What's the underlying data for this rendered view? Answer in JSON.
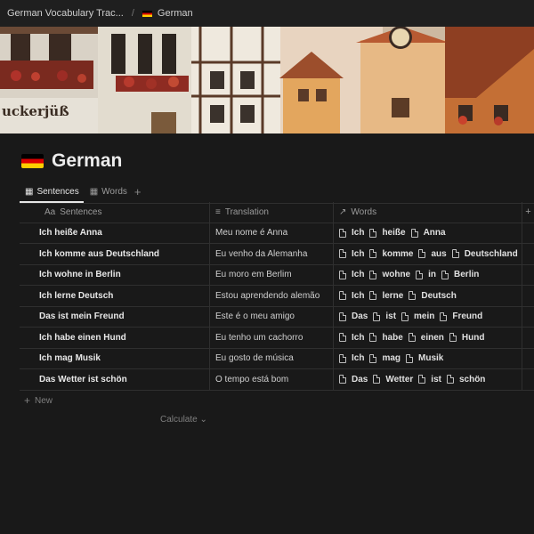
{
  "breadcrumb": {
    "parent": "German Vocabulary Trac...",
    "separator": "/",
    "current": "German"
  },
  "page": {
    "title": "German"
  },
  "views": {
    "tabs": [
      {
        "label": "Sentences",
        "icon": "table-icon",
        "active": true
      },
      {
        "label": "Words",
        "icon": "table-icon",
        "active": false
      }
    ],
    "add": "+"
  },
  "table": {
    "columns": [
      {
        "label": "Sentences",
        "icon": "Aa"
      },
      {
        "label": "Translation",
        "icon": "text-lines-icon"
      },
      {
        "label": "Words",
        "icon": "relation-arrow-icon"
      }
    ],
    "rows": [
      {
        "sentence": "Ich heiße Anna",
        "translation": "Meu nome é Anna",
        "words": [
          "Ich",
          "heiße",
          "Anna"
        ]
      },
      {
        "sentence": "Ich komme aus Deutschland",
        "translation": "Eu venho da Alemanha",
        "words": [
          "Ich",
          "komme",
          "aus",
          "Deutschland"
        ]
      },
      {
        "sentence": "Ich wohne in Berlin",
        "translation": "Eu moro em Berlim",
        "words": [
          "Ich",
          "wohne",
          "in",
          "Berlin"
        ]
      },
      {
        "sentence": "Ich lerne Deutsch",
        "translation": "Estou aprendendo alemão",
        "words": [
          "Ich",
          "lerne",
          "Deutsch"
        ]
      },
      {
        "sentence": "Das ist mein Freund",
        "translation": "Este é o meu amigo",
        "words": [
          "Das",
          "ist",
          "mein",
          "Freund"
        ]
      },
      {
        "sentence": "Ich habe einen Hund",
        "translation": "Eu tenho um cachorro",
        "words": [
          "Ich",
          "habe",
          "einen",
          "Hund"
        ]
      },
      {
        "sentence": "Ich mag Musik",
        "translation": "Eu gosto de música",
        "words": [
          "Ich",
          "mag",
          "Musik"
        ]
      },
      {
        "sentence": "Das Wetter ist schön",
        "translation": "O tempo está bom",
        "words": [
          "Das",
          "Wetter",
          "ist",
          "schön"
        ]
      }
    ],
    "new_label": "New",
    "calculate_label": "Calculate"
  },
  "cover": {
    "sign_text": "uckerjüß"
  },
  "colors": {
    "background": "#191919",
    "flag_black": "#000000",
    "flag_red": "#dd0000",
    "flag_gold": "#ffce00"
  }
}
